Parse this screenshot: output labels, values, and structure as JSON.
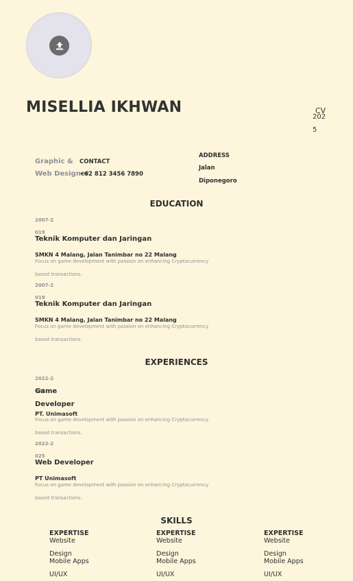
{
  "profile": {
    "name": "MISELLIA IKHWAN",
    "cv_label": "CV",
    "year_part1": "202",
    "year_part2": "5",
    "role_line1": "Graphic &",
    "role_line2": "Web Designer",
    "contact_label": "CONTACT",
    "contact_phone": "+62 812 3456 7890",
    "address_label": "ADDRESS",
    "address_line1": "Jalan",
    "address_line2": "Diponegoro"
  },
  "icons": {
    "upload": "upload-icon"
  },
  "education": {
    "title": "EDUCATION",
    "items": [
      {
        "date_a": "2007-2",
        "date_b": "019",
        "degree": "Teknik Komputer dan Jaringan",
        "school": "SMKN 4 Malang, Jalan Tanimbar no 22 Malang",
        "desc_a": "Focus on game development with passion on enhancing Cryptocurrency",
        "desc_b": "based transactions."
      },
      {
        "date_a": "2007-2",
        "date_b": "019",
        "degree": "Teknik Komputer dan Jaringan",
        "school": "SMKN 4 Malang, Jalan Tanimbar no 22 Malang",
        "desc_a": "Focus on game development with passion on enhancing Cryptocurrency",
        "desc_b": "based transactions."
      }
    ]
  },
  "experiences": {
    "title": "EXPERIENCES",
    "items": [
      {
        "date_a": "2022-2",
        "date_b": "025",
        "role_a": "Game",
        "role_b": "Developer",
        "company": "PT. Unimasoft",
        "desc_a": "Focus on game development with passion on enhancing Cryptocurrency",
        "desc_b": "based transactions."
      },
      {
        "date_a": "2022-2",
        "date_b": "025",
        "role": "Web Developer",
        "company": "PT Unimasoft",
        "desc_a": "Focus on game development with passion on enhancing Cryptocurrency",
        "desc_b": "based transactions."
      }
    ]
  },
  "skills": {
    "title": "SKILLS",
    "columns": [
      {
        "head": "EXPERTISE",
        "item1": "Website",
        "item2": "Design",
        "item3": "Mobile Apps",
        "item4": "UI/UX"
      },
      {
        "head": "EXPERTISE",
        "item1": "Website",
        "item2": "Design",
        "item3": "Mobile Apps",
        "item4": "UI/UX"
      },
      {
        "head": "EXPERTISE",
        "item1": "Website",
        "item2": "Design",
        "item3": "Mobile Apps",
        "item4": "UI/UX"
      }
    ]
  }
}
